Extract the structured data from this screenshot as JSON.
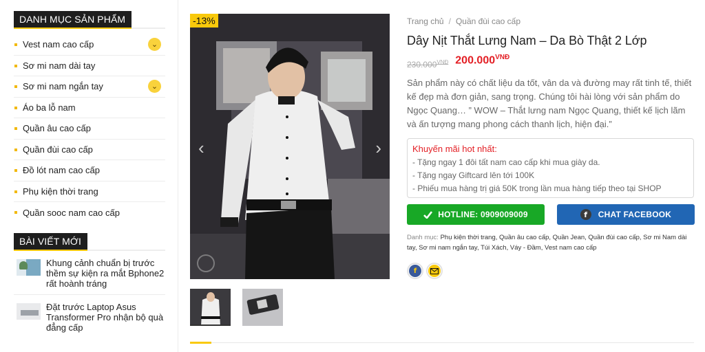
{
  "sidebar": {
    "categories_title": "DANH MỤC SẢN PHẨM",
    "categories": [
      {
        "label": "Vest nam cao cấp",
        "has_toggle": true
      },
      {
        "label": "Sơ mi nam dài tay",
        "has_toggle": false
      },
      {
        "label": "Sơ mi nam ngắn tay",
        "has_toggle": true
      },
      {
        "label": "Áo ba lỗ nam",
        "has_toggle": false
      },
      {
        "label": "Quần âu cao cấp",
        "has_toggle": false
      },
      {
        "label": "Quần đùi cao cấp",
        "has_toggle": false
      },
      {
        "label": "Đồ lót nam cao cấp",
        "has_toggle": false
      },
      {
        "label": "Phụ kiện thời trang",
        "has_toggle": false
      },
      {
        "label": "Quần sooc nam cao cấp",
        "has_toggle": false
      }
    ],
    "posts_title": "BÀI VIẾT MỚI",
    "posts": [
      {
        "title": "Khung cảnh chuẩn bị trước thềm sự kiện ra mắt Bphone2 rất hoành tráng"
      },
      {
        "title": "Đặt trước Laptop Asus Transformer Pro nhận bộ quà đẳng cấp"
      }
    ]
  },
  "gallery": {
    "sale_badge": "-13%",
    "prev_arrow": "‹",
    "next_arrow": "›"
  },
  "product": {
    "breadcrumb": [
      "Trang chủ",
      "Quần đùi cao cấp"
    ],
    "breadcrumb_sep": "/",
    "title": "Dây Nịt Thắt Lưng Nam – Da Bò Thật 2 Lớp",
    "old_price": "230.000",
    "old_price_unit": "VNĐ",
    "new_price": "200.000",
    "new_price_unit": "VNĐ",
    "description": "Sản phẩm này có chất liệu da tốt, vân da và đường may rất tinh tế, thiết kế đẹp mà đơn giản, sang trọng. Chúng tôi hài lòng với sản phẩm do Ngọc Quang… ” WOW – Thắt lưng nam Ngọc Quang, thiết kế lịch lãm và ấn tượng mang phong cách thanh lịch, hiện đại.”",
    "promo_title": "Khuyến mãi hot nhất:",
    "promo_lines": [
      "- Tặng ngay 1 đôi tất nam cao cấp khi mua giày da.",
      "- Tặng ngay Giftcard lên tới 100K",
      "- Phiếu mua hàng trị giá 50K trong lần mua hàng tiếp theo tại SHOP"
    ],
    "hotline_label": "HOTLINE: 0909009009",
    "facebook_label": "CHAT FACEBOOK",
    "categories_label": "Danh mục:",
    "categories_text": "Phụ kiện thời trang, Quần âu cao cấp, Quần Jean, Quần đùi cao cấp, Sơ mi Nam dài tay, Sơ mi nam ngắn tay, Túi Xách, Váy - Đầm, Vest nam cao cấp"
  },
  "icons": {
    "chevron": "⌄",
    "fb_letter": "f"
  },
  "colors": {
    "accent": "#f9c90b",
    "price_red": "#e31e24",
    "hotline_green": "#18a826",
    "facebook_blue": "#2166b4"
  }
}
